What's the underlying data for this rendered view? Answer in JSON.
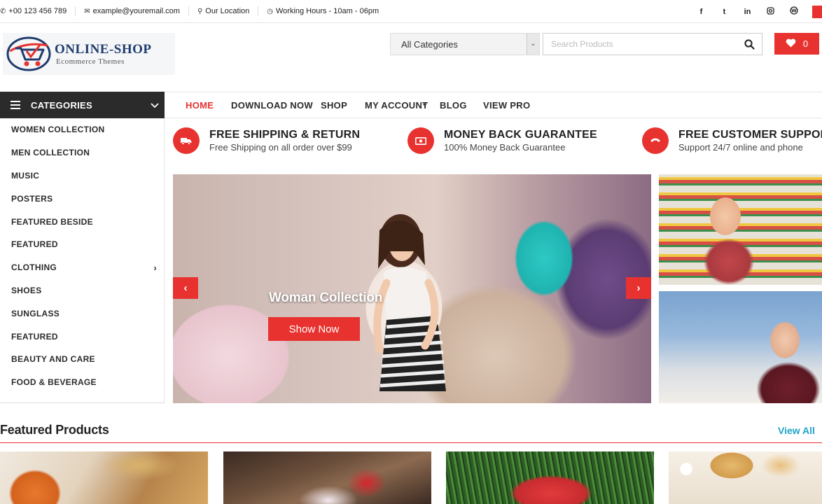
{
  "topbar": {
    "phone": "+00 123 456 789",
    "email": "example@youremail.com",
    "location": "Our Location",
    "hours": "Working Hours - 10am - 06pm",
    "social": [
      "f",
      "t",
      "in",
      "ig",
      "wp"
    ]
  },
  "logo": {
    "title": "ONLINE-SHOP",
    "subtitle": "Ecommerce Themes"
  },
  "search": {
    "category": "All Categories",
    "placeholder": "Search Products"
  },
  "wishlist": {
    "count": "0"
  },
  "categories": {
    "title": "CATEGORIES",
    "items": [
      {
        "label": "WOMEN COLLECTION"
      },
      {
        "label": "MEN COLLECTION"
      },
      {
        "label": "MUSIC"
      },
      {
        "label": "POSTERS"
      },
      {
        "label": "FEATURED BESIDE"
      },
      {
        "label": "FEATURED"
      },
      {
        "label": "CLOTHING",
        "has_sub": true
      },
      {
        "label": "SHOES"
      },
      {
        "label": "SUNGLASS"
      },
      {
        "label": "FEATURED"
      },
      {
        "label": "BEAUTY AND CARE"
      },
      {
        "label": "FOOD & BEVERAGE"
      }
    ]
  },
  "nav": {
    "items": [
      "HOME",
      "DOWNLOAD NOW",
      "SHOP",
      "MY ACCOUNT",
      "BLOG",
      "VIEW PRO"
    ],
    "active": "HOME"
  },
  "features": [
    {
      "title": "FREE SHIPPING & RETURN",
      "subtitle": "Free Shipping on all order over $99",
      "icon": "truck-icon"
    },
    {
      "title": "MONEY BACK GUARANTEE",
      "subtitle": "100% Money Back Guarantee",
      "icon": "money-icon"
    },
    {
      "title": "FREE CUSTOMER SUPPORT",
      "subtitle": "Support 24/7 online and phone",
      "icon": "phone-icon"
    }
  ],
  "slider": {
    "caption": "Woman Collection",
    "button": "Show Now"
  },
  "featured_products": {
    "title": "Featured Products",
    "view_all": "View All"
  },
  "colors": {
    "accent": "#e8322f",
    "dark": "#2b2b2b",
    "link": "#1fa4c9",
    "logo_blue": "#1f3c6e"
  }
}
